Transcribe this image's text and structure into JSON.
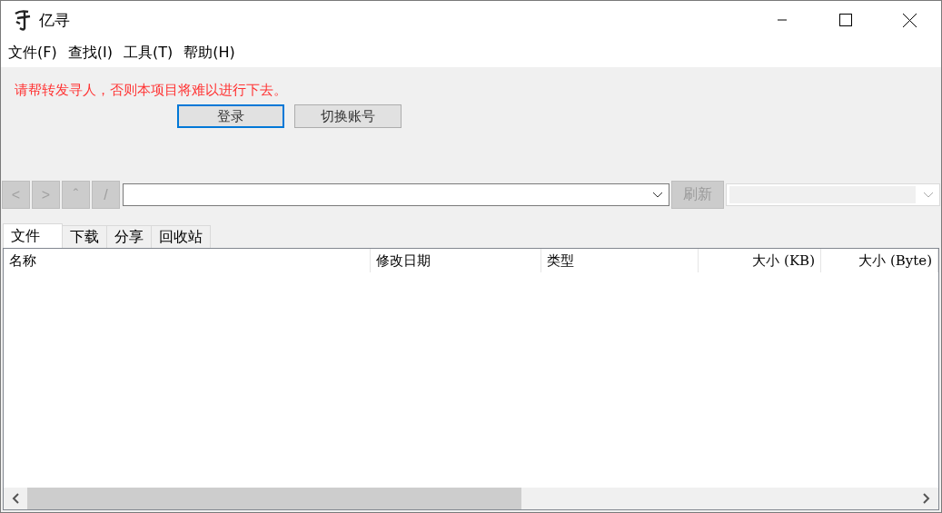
{
  "window": {
    "title": "亿寻"
  },
  "menu": [
    {
      "label": "文件(F)"
    },
    {
      "label": "查找(I)"
    },
    {
      "label": "工具(T)"
    },
    {
      "label": "帮助(H)"
    }
  ],
  "notice": "请帮转发寻人，否则本项目将难以进行下去。",
  "account_buttons": [
    {
      "label": "登录",
      "selected": true
    },
    {
      "label": "切换账号",
      "selected": false
    }
  ],
  "nav_buttons": [
    {
      "label": "<",
      "disabled": true
    },
    {
      "label": ">",
      "disabled": true
    },
    {
      "label": "ˆ",
      "disabled": true
    },
    {
      "label": "/",
      "disabled": true
    }
  ],
  "refresh_button": {
    "label": "刷新",
    "disabled": true
  },
  "second_dropdown": {
    "disabled": true
  },
  "tabs": [
    {
      "label": "文件",
      "selected": true
    },
    {
      "label": "下载",
      "selected": false
    },
    {
      "label": "分享",
      "selected": false
    },
    {
      "label": "回收站",
      "selected": false
    }
  ],
  "table": {
    "columns": [
      {
        "label": "名称"
      },
      {
        "label": "修改日期"
      },
      {
        "label": "类型"
      },
      {
        "label": "大小 (KB)"
      },
      {
        "label": "大小 (Byte)"
      }
    ]
  }
}
